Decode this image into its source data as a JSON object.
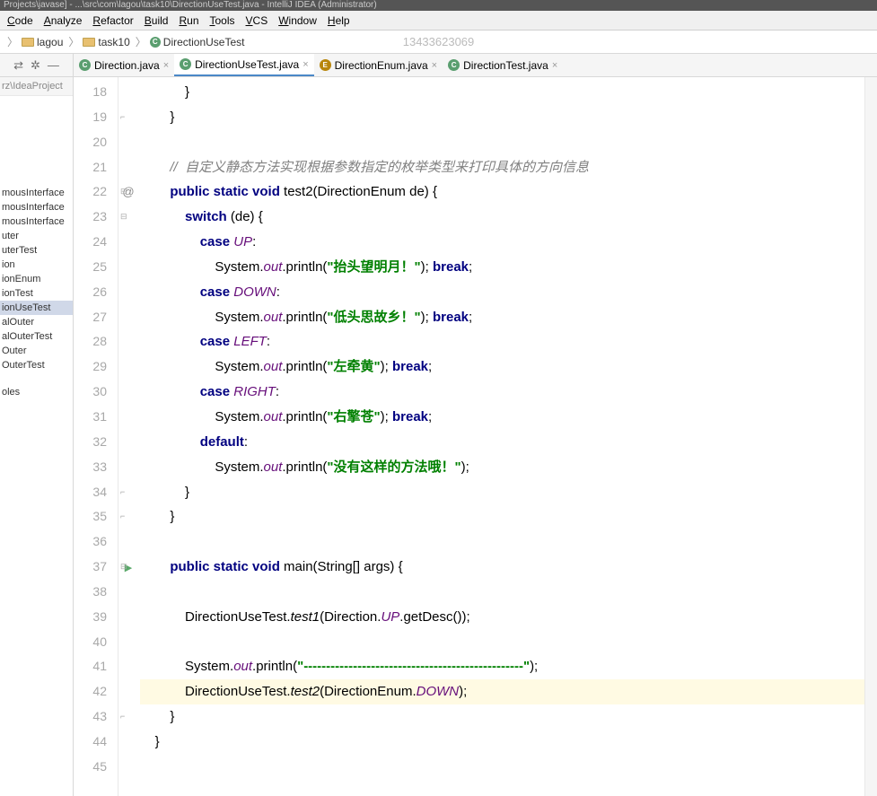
{
  "title": "Projects\\javase] - ...\\src\\com\\lagou\\task10\\DirectionUseTest.java - IntelliJ IDEA (Administrator)",
  "menu": [
    "Code",
    "Analyze",
    "Refactor",
    "Build",
    "Run",
    "Tools",
    "VCS",
    "Window",
    "Help"
  ],
  "menu_u": [
    "C",
    "A",
    "R",
    "B",
    "R",
    "T",
    "V",
    "W",
    "H"
  ],
  "breadcrumbs": [
    {
      "icon": "folder",
      "label": "lagou"
    },
    {
      "icon": "folder",
      "label": "task10"
    },
    {
      "icon": "class",
      "label": "DirectionUseTest"
    }
  ],
  "watermark": "13433623069",
  "tabs": [
    {
      "icon": "c",
      "label": "Direction.java",
      "active": false
    },
    {
      "icon": "c",
      "label": "DirectionUseTest.java",
      "active": true
    },
    {
      "icon": "e",
      "label": "DirectionEnum.java",
      "active": false
    },
    {
      "icon": "c",
      "label": "DirectionTest.java",
      "active": false
    }
  ],
  "side_path": "rz\\IdeaProject",
  "side_items": [
    "mousInterface",
    "mousInterface",
    "mousInterface",
    "uter",
    "uterTest",
    "ion",
    "ionEnum",
    "ionTest",
    "ionUseTest",
    "alOuter",
    "alOuterTest",
    "Outer",
    "OuterTest"
  ],
  "side_items2": [
    "oles"
  ],
  "side_selected": 8,
  "line_start": 18,
  "line_end": 45,
  "code_lines": [
    {
      "n": 18,
      "html": "            }"
    },
    {
      "n": 19,
      "html": "        }"
    },
    {
      "n": 20,
      "html": ""
    },
    {
      "n": 21,
      "html": "        <span class='cm'>//  自定义静态方法实现根据参数指定的枚举类型来打印具体的方向信息</span>"
    },
    {
      "n": 22,
      "html": "        <span class='kw'>public static void</span> test2(DirectionEnum de) {"
    },
    {
      "n": 23,
      "html": "            <span class='kw'>switch</span> (de) {"
    },
    {
      "n": 24,
      "html": "                <span class='kw'>case</span> <span class='fld'>UP</span>:"
    },
    {
      "n": 25,
      "html": "                    System.<span class='fld'>out</span>.println(<span class='str'>\"抬头望明月！\"</span>); <span class='kw'>break</span>;"
    },
    {
      "n": 26,
      "html": "                <span class='kw'>case</span> <span class='fld'>DOWN</span>:"
    },
    {
      "n": 27,
      "html": "                    System.<span class='fld'>out</span>.println(<span class='str'>\"低头思故乡！\"</span>); <span class='kw'>break</span>;"
    },
    {
      "n": 28,
      "html": "                <span class='kw'>case</span> <span class='fld'>LEFT</span>:"
    },
    {
      "n": 29,
      "html": "                    System.<span class='fld'>out</span>.println(<span class='str'>\"左牵黄\"</span>); <span class='kw'>break</span>;"
    },
    {
      "n": 30,
      "html": "                <span class='kw'>case</span> <span class='fld'>RIGHT</span>:"
    },
    {
      "n": 31,
      "html": "                    System.<span class='fld'>out</span>.println(<span class='str'>\"右擎苍\"</span>); <span class='kw'>break</span>;"
    },
    {
      "n": 32,
      "html": "                <span class='kw'>default</span>:"
    },
    {
      "n": 33,
      "html": "                    System.<span class='fld'>out</span>.println(<span class='str'>\"没有这样的方法哦！\"</span>);"
    },
    {
      "n": 34,
      "html": "            }"
    },
    {
      "n": 35,
      "html": "        }"
    },
    {
      "n": 36,
      "html": ""
    },
    {
      "n": 37,
      "html": "        <span class='kw'>public static void</span> main(String[] args) {"
    },
    {
      "n": 38,
      "html": ""
    },
    {
      "n": 39,
      "html": "            DirectionUseTest.<span class='mtd'>test1</span>(Direction.<span class='fld'>UP</span>.getDesc());"
    },
    {
      "n": 40,
      "html": ""
    },
    {
      "n": 41,
      "html": "            System.<span class='fld'>out</span>.println(<span class='str'>\"-------------------------------------------------\"</span>);"
    },
    {
      "n": 42,
      "html": "            DirectionUseTest.<span class='mtd'>test2</span>(DirectionEnum.<span class='fld'>DOWN</span>);",
      "hl": true
    },
    {
      "n": 43,
      "html": "        }"
    },
    {
      "n": 44,
      "html": "    }"
    },
    {
      "n": 45,
      "html": ""
    }
  ]
}
